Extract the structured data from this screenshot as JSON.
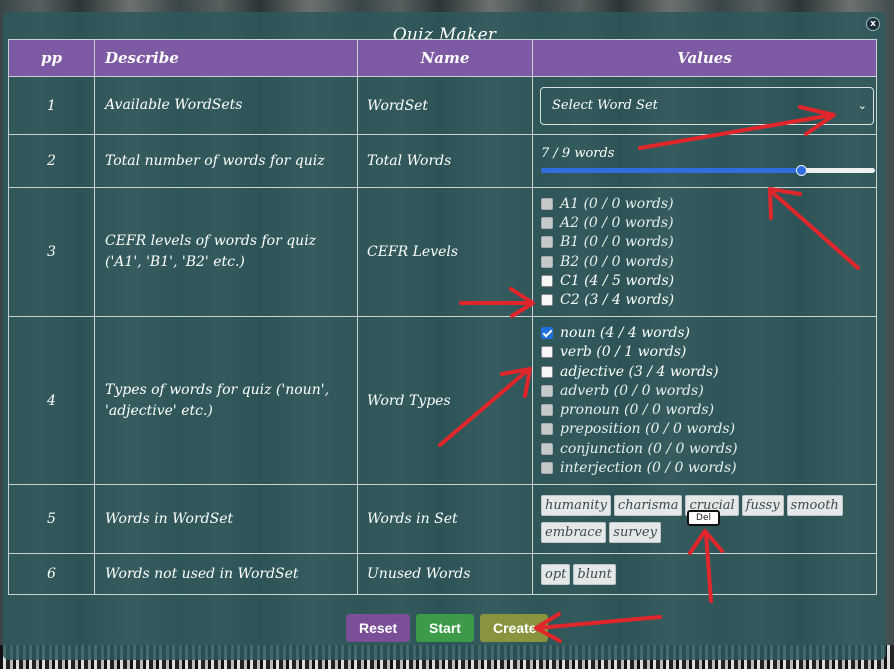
{
  "modal": {
    "title": "Quiz Maker",
    "close_label": "x"
  },
  "table": {
    "headers": {
      "pp": "pp",
      "describe": "Describe",
      "name": "Name",
      "values": "Values"
    },
    "rows": [
      {
        "pp": "1",
        "describe": "Available WordSets",
        "name": "WordSet"
      },
      {
        "pp": "2",
        "describe": "Total number of words for quiz",
        "name": "Total Words"
      },
      {
        "pp": "3",
        "describe": "CEFR levels of words for quiz ('A1', 'B1', 'B2' etc.)",
        "name": "CEFR Levels"
      },
      {
        "pp": "4",
        "describe": "Types of words for quiz ('noun', 'adjective' etc.)",
        "name": "Word Types"
      },
      {
        "pp": "5",
        "describe": "Words in WordSet",
        "name": "Words in Set"
      },
      {
        "pp": "6",
        "describe": "Words not used in WordSet",
        "name": "Unused Words"
      }
    ]
  },
  "wordset_select": {
    "selected": "Select Word Set"
  },
  "total_words": {
    "label": "7 / 9 words",
    "value": 7,
    "max": 9
  },
  "cefr_levels": [
    {
      "label": "A1 (0 / 0 words)",
      "state": "disabled"
    },
    {
      "label": "A2 (0 / 0 words)",
      "state": "disabled"
    },
    {
      "label": "B1 (0 / 0 words)",
      "state": "disabled"
    },
    {
      "label": "B2 (0 / 0 words)",
      "state": "disabled"
    },
    {
      "label": "C1 (4 / 5 words)",
      "state": "unchecked"
    },
    {
      "label": "C2 (3 / 4 words)",
      "state": "unchecked"
    }
  ],
  "word_types": [
    {
      "label": "noun (4 / 4 words)",
      "state": "checked"
    },
    {
      "label": "verb (0 / 1 words)",
      "state": "unchecked"
    },
    {
      "label": "adjective (3 / 4 words)",
      "state": "unchecked"
    },
    {
      "label": "adverb (0 / 0 words)",
      "state": "disabled"
    },
    {
      "label": "pronoun (0 / 0 words)",
      "state": "disabled"
    },
    {
      "label": "preposition (0 / 0 words)",
      "state": "disabled"
    },
    {
      "label": "conjunction (0 / 0 words)",
      "state": "disabled"
    },
    {
      "label": "interjection (0 / 0 words)",
      "state": "disabled"
    }
  ],
  "words_in_set": [
    "humanity",
    "charisma",
    "crucial",
    "fussy",
    "smooth",
    "embrace",
    "survey"
  ],
  "unused_words": [
    "opt",
    "blunt"
  ],
  "delete_tooltip": "Del",
  "buttons": {
    "reset": "Reset",
    "start": "Start",
    "create": "Create"
  },
  "colors": {
    "header_bg": "#7e5aa4",
    "modal_bg": "#2d585c",
    "slider": "#2f6de0",
    "annotation_arrow": "#e0262b"
  }
}
